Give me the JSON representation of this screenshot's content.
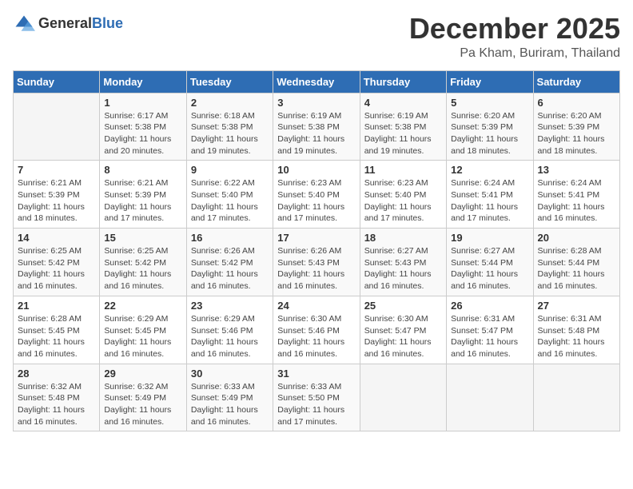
{
  "logo": {
    "general": "General",
    "blue": "Blue"
  },
  "header": {
    "month": "December 2025",
    "location": "Pa Kham, Buriram, Thailand"
  },
  "days_of_week": [
    "Sunday",
    "Monday",
    "Tuesday",
    "Wednesday",
    "Thursday",
    "Friday",
    "Saturday"
  ],
  "weeks": [
    [
      {
        "day": "",
        "sunrise": "",
        "sunset": "",
        "daylight": ""
      },
      {
        "day": "1",
        "sunrise": "Sunrise: 6:17 AM",
        "sunset": "Sunset: 5:38 PM",
        "daylight": "Daylight: 11 hours and 20 minutes."
      },
      {
        "day": "2",
        "sunrise": "Sunrise: 6:18 AM",
        "sunset": "Sunset: 5:38 PM",
        "daylight": "Daylight: 11 hours and 19 minutes."
      },
      {
        "day": "3",
        "sunrise": "Sunrise: 6:19 AM",
        "sunset": "Sunset: 5:38 PM",
        "daylight": "Daylight: 11 hours and 19 minutes."
      },
      {
        "day": "4",
        "sunrise": "Sunrise: 6:19 AM",
        "sunset": "Sunset: 5:38 PM",
        "daylight": "Daylight: 11 hours and 19 minutes."
      },
      {
        "day": "5",
        "sunrise": "Sunrise: 6:20 AM",
        "sunset": "Sunset: 5:39 PM",
        "daylight": "Daylight: 11 hours and 18 minutes."
      },
      {
        "day": "6",
        "sunrise": "Sunrise: 6:20 AM",
        "sunset": "Sunset: 5:39 PM",
        "daylight": "Daylight: 11 hours and 18 minutes."
      }
    ],
    [
      {
        "day": "7",
        "sunrise": "Sunrise: 6:21 AM",
        "sunset": "Sunset: 5:39 PM",
        "daylight": "Daylight: 11 hours and 18 minutes."
      },
      {
        "day": "8",
        "sunrise": "Sunrise: 6:21 AM",
        "sunset": "Sunset: 5:39 PM",
        "daylight": "Daylight: 11 hours and 17 minutes."
      },
      {
        "day": "9",
        "sunrise": "Sunrise: 6:22 AM",
        "sunset": "Sunset: 5:40 PM",
        "daylight": "Daylight: 11 hours and 17 minutes."
      },
      {
        "day": "10",
        "sunrise": "Sunrise: 6:23 AM",
        "sunset": "Sunset: 5:40 PM",
        "daylight": "Daylight: 11 hours and 17 minutes."
      },
      {
        "day": "11",
        "sunrise": "Sunrise: 6:23 AM",
        "sunset": "Sunset: 5:40 PM",
        "daylight": "Daylight: 11 hours and 17 minutes."
      },
      {
        "day": "12",
        "sunrise": "Sunrise: 6:24 AM",
        "sunset": "Sunset: 5:41 PM",
        "daylight": "Daylight: 11 hours and 17 minutes."
      },
      {
        "day": "13",
        "sunrise": "Sunrise: 6:24 AM",
        "sunset": "Sunset: 5:41 PM",
        "daylight": "Daylight: 11 hours and 16 minutes."
      }
    ],
    [
      {
        "day": "14",
        "sunrise": "Sunrise: 6:25 AM",
        "sunset": "Sunset: 5:42 PM",
        "daylight": "Daylight: 11 hours and 16 minutes."
      },
      {
        "day": "15",
        "sunrise": "Sunrise: 6:25 AM",
        "sunset": "Sunset: 5:42 PM",
        "daylight": "Daylight: 11 hours and 16 minutes."
      },
      {
        "day": "16",
        "sunrise": "Sunrise: 6:26 AM",
        "sunset": "Sunset: 5:42 PM",
        "daylight": "Daylight: 11 hours and 16 minutes."
      },
      {
        "day": "17",
        "sunrise": "Sunrise: 6:26 AM",
        "sunset": "Sunset: 5:43 PM",
        "daylight": "Daylight: 11 hours and 16 minutes."
      },
      {
        "day": "18",
        "sunrise": "Sunrise: 6:27 AM",
        "sunset": "Sunset: 5:43 PM",
        "daylight": "Daylight: 11 hours and 16 minutes."
      },
      {
        "day": "19",
        "sunrise": "Sunrise: 6:27 AM",
        "sunset": "Sunset: 5:44 PM",
        "daylight": "Daylight: 11 hours and 16 minutes."
      },
      {
        "day": "20",
        "sunrise": "Sunrise: 6:28 AM",
        "sunset": "Sunset: 5:44 PM",
        "daylight": "Daylight: 11 hours and 16 minutes."
      }
    ],
    [
      {
        "day": "21",
        "sunrise": "Sunrise: 6:28 AM",
        "sunset": "Sunset: 5:45 PM",
        "daylight": "Daylight: 11 hours and 16 minutes."
      },
      {
        "day": "22",
        "sunrise": "Sunrise: 6:29 AM",
        "sunset": "Sunset: 5:45 PM",
        "daylight": "Daylight: 11 hours and 16 minutes."
      },
      {
        "day": "23",
        "sunrise": "Sunrise: 6:29 AM",
        "sunset": "Sunset: 5:46 PM",
        "daylight": "Daylight: 11 hours and 16 minutes."
      },
      {
        "day": "24",
        "sunrise": "Sunrise: 6:30 AM",
        "sunset": "Sunset: 5:46 PM",
        "daylight": "Daylight: 11 hours and 16 minutes."
      },
      {
        "day": "25",
        "sunrise": "Sunrise: 6:30 AM",
        "sunset": "Sunset: 5:47 PM",
        "daylight": "Daylight: 11 hours and 16 minutes."
      },
      {
        "day": "26",
        "sunrise": "Sunrise: 6:31 AM",
        "sunset": "Sunset: 5:47 PM",
        "daylight": "Daylight: 11 hours and 16 minutes."
      },
      {
        "day": "27",
        "sunrise": "Sunrise: 6:31 AM",
        "sunset": "Sunset: 5:48 PM",
        "daylight": "Daylight: 11 hours and 16 minutes."
      }
    ],
    [
      {
        "day": "28",
        "sunrise": "Sunrise: 6:32 AM",
        "sunset": "Sunset: 5:48 PM",
        "daylight": "Daylight: 11 hours and 16 minutes."
      },
      {
        "day": "29",
        "sunrise": "Sunrise: 6:32 AM",
        "sunset": "Sunset: 5:49 PM",
        "daylight": "Daylight: 11 hours and 16 minutes."
      },
      {
        "day": "30",
        "sunrise": "Sunrise: 6:33 AM",
        "sunset": "Sunset: 5:49 PM",
        "daylight": "Daylight: 11 hours and 16 minutes."
      },
      {
        "day": "31",
        "sunrise": "Sunrise: 6:33 AM",
        "sunset": "Sunset: 5:50 PM",
        "daylight": "Daylight: 11 hours and 17 minutes."
      },
      {
        "day": "",
        "sunrise": "",
        "sunset": "",
        "daylight": ""
      },
      {
        "day": "",
        "sunrise": "",
        "sunset": "",
        "daylight": ""
      },
      {
        "day": "",
        "sunrise": "",
        "sunset": "",
        "daylight": ""
      }
    ]
  ]
}
